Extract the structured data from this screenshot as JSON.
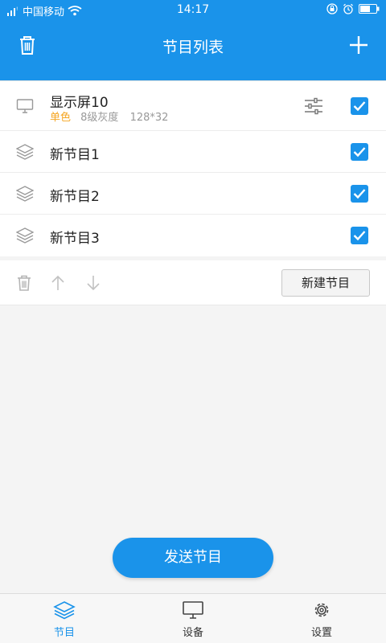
{
  "status_bar": {
    "carrier": "中国移动",
    "time": "14:17"
  },
  "header": {
    "title": "节目列表",
    "left_icon": "trash-icon",
    "right_icon": "plus-icon"
  },
  "device": {
    "name": "显示屏10",
    "color_mode": "单色",
    "gray_level": "8级灰度",
    "resolution": "128*32",
    "checked": true
  },
  "programs": [
    {
      "name": "新节目1",
      "checked": true
    },
    {
      "name": "新节目2",
      "checked": true
    },
    {
      "name": "新节目3",
      "checked": true
    }
  ],
  "toolbar": {
    "new_program_label": "新建节目"
  },
  "send_button_label": "发送节目",
  "bottom_nav": [
    {
      "label": "节目",
      "icon": "layers-icon",
      "active": true
    },
    {
      "label": "设备",
      "icon": "monitor-icon",
      "active": false
    },
    {
      "label": "设置",
      "icon": "gear-icon",
      "active": false
    }
  ],
  "colors": {
    "primary": "#1a93ea",
    "accent_orange": "#f5a623"
  }
}
